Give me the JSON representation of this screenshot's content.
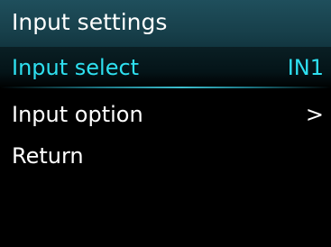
{
  "header": {
    "title": "Input settings"
  },
  "menu": {
    "items": [
      {
        "label": "Input select",
        "value": "IN1",
        "selected": true
      },
      {
        "label": "Input option",
        "value": ">",
        "selected": false
      },
      {
        "label": "Return",
        "value": "",
        "selected": false
      }
    ]
  },
  "colors": {
    "title_bar": "#1f4f5c",
    "selected_text": "#2ee0f0",
    "normal_text": "#ffffff",
    "background": "#000000"
  }
}
